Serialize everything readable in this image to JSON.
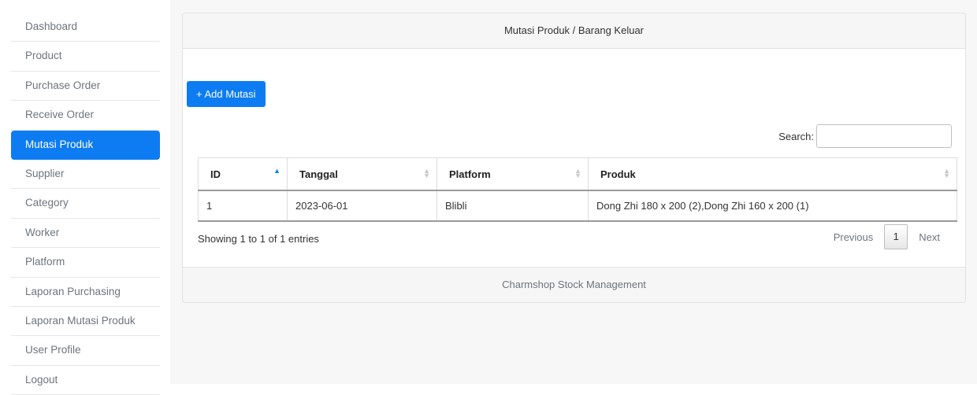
{
  "sidebar": {
    "items": [
      {
        "label": "Dashboard",
        "active": false
      },
      {
        "label": "Product",
        "active": false
      },
      {
        "label": "Purchase Order",
        "active": false
      },
      {
        "label": "Receive Order",
        "active": false
      },
      {
        "label": "Mutasi Produk",
        "active": true
      },
      {
        "label": "Supplier",
        "active": false
      },
      {
        "label": "Category",
        "active": false
      },
      {
        "label": "Worker",
        "active": false
      },
      {
        "label": "Platform",
        "active": false
      },
      {
        "label": "Laporan Purchasing",
        "active": false
      },
      {
        "label": "Laporan Mutasi Produk",
        "active": false
      },
      {
        "label": "User Profile",
        "active": false
      },
      {
        "label": "Logout",
        "active": false
      }
    ]
  },
  "card": {
    "title": "Mutasi Produk / Barang Keluar",
    "add_button": "+ Add Mutasi",
    "footer": "Charmshop Stock Management"
  },
  "search": {
    "label": "Search:",
    "value": ""
  },
  "table": {
    "headers": [
      "ID",
      "Tanggal",
      "Platform",
      "Produk"
    ],
    "rows": [
      [
        "1",
        "2023-06-01",
        "Blibli",
        "Dong Zhi 180 x 200 (2),Dong Zhi 160 x 200 (1)"
      ]
    ]
  },
  "info": "Showing 1 to 1 of 1 entries",
  "pagination": {
    "previous": "Previous",
    "page": "1",
    "next": "Next"
  },
  "colors": {
    "primary": "#0d7cf2"
  }
}
